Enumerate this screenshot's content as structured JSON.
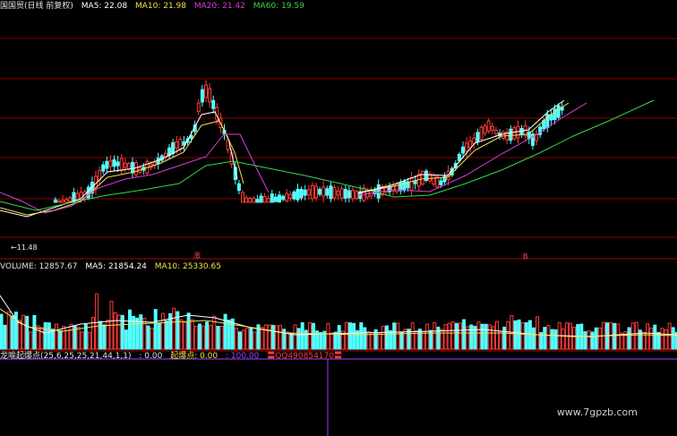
{
  "price_header": {
    "title": "国国贸(日线 前复权)",
    "ma5": "MA5: 22.08",
    "ma10": "MA10: 21.98",
    "ma20": "MA20: 21.42",
    "ma60": "MA60: 19.59"
  },
  "price_low_label": "←11.48",
  "markers": {
    "up": "涨",
    "down": "B"
  },
  "volume_header": {
    "volume": "VOLUME: 12857.67",
    "ma5": "MA5: 21854.24",
    "ma10": "MA10: 25330.65"
  },
  "indicator_header": {
    "name": "龙喻起爆点(25,6,25,25,21,44,1,1)",
    "v1": ": 0.00",
    "label": "起爆点: 0.00",
    "v2": ": 100.00",
    "v3": "〓QQ490854170〓"
  },
  "watermark": "www.7gpzb.com",
  "colors": {
    "up": "#ff3b3b",
    "down": "#54ffff",
    "ma5": "#ffffff",
    "ma10": "#f3e04a",
    "ma20": "#d63fd6",
    "ma60": "#37d64a",
    "grid": "#8a0000",
    "indicator_line": "#a040ff"
  }
}
